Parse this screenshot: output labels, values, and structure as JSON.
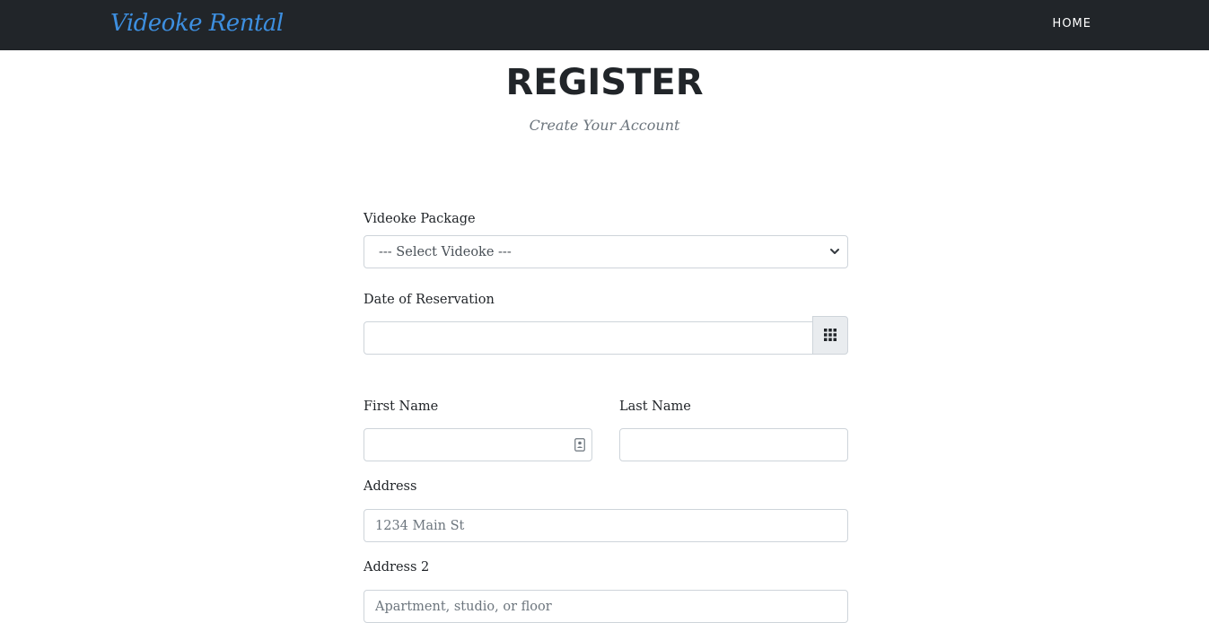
{
  "navbar": {
    "brand": "Videoke Rental",
    "home": "HOME"
  },
  "header": {
    "title": "REGISTER",
    "subtitle": "Create Your Account"
  },
  "form": {
    "package": {
      "label": "Videoke Package",
      "selected": "--- Select Videoke ---"
    },
    "date": {
      "label": "Date of Reservation",
      "value": ""
    },
    "first_name": {
      "label": "First Name",
      "value": ""
    },
    "last_name": {
      "label": "Last Name",
      "value": ""
    },
    "address": {
      "label": "Address",
      "placeholder": "1234 Main St"
    },
    "address2": {
      "label": "Address 2",
      "placeholder": "Apartment, studio, or floor"
    }
  },
  "icons": {
    "calendar": "grid-calendar-icon",
    "contact": "contact-card-icon",
    "select": "chevron-down-icon"
  },
  "colors": {
    "navbar_bg": "#212529",
    "brand": "#3d8fe0",
    "muted_text": "#6c757d",
    "input_border": "#ced4da"
  }
}
